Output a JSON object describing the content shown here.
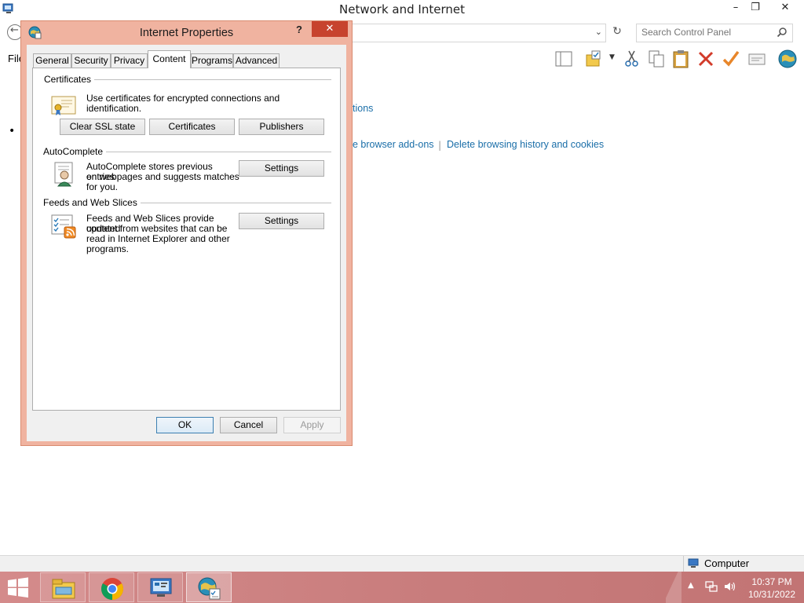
{
  "background_window": {
    "title": "Network and Internet",
    "caption_minimize": "–",
    "caption_restore": "❐",
    "caption_close": "✕",
    "search_placeholder": "Search Control Panel",
    "menu_file": "File",
    "content_fragment_1": "tions",
    "content_fragment_2": "e browser add-ons",
    "separator": "|",
    "link_delete_history": "Delete browsing history and cookies",
    "bullet": "•",
    "status_computer": "Computer"
  },
  "dialog": {
    "title": "Internet Properties",
    "help_button": "?",
    "close_button": "✕",
    "tabs": [
      {
        "label": "General"
      },
      {
        "label": "Security"
      },
      {
        "label": "Privacy"
      },
      {
        "label": "Content"
      },
      {
        "label": "Programs"
      },
      {
        "label": "Advanced"
      }
    ],
    "active_tab": "Content",
    "certificates": {
      "title": "Certificates",
      "description": "Use certificates for encrypted connections and identification.",
      "buttons": [
        "Clear SSL state",
        "Certificates",
        "Publishers"
      ]
    },
    "autocomplete": {
      "title": "AutoComplete",
      "description_lines": [
        "AutoComplete stores previous entries",
        "on webpages and suggests matches",
        "for you."
      ],
      "settings_button": "Settings"
    },
    "feeds": {
      "title": "Feeds and Web Slices",
      "description_lines": [
        "Feeds and Web Slices provide updated",
        "content from websites that can be",
        "read in Internet Explorer and other",
        "programs."
      ],
      "settings_button": "Settings"
    },
    "footer": {
      "ok": "OK",
      "cancel": "Cancel",
      "apply": "Apply"
    }
  },
  "taskbar": {
    "apps": [
      "file-explorer",
      "chrome",
      "control-panel",
      "internet-properties"
    ],
    "active_app": "internet-properties",
    "clock_time": "10:37 PM",
    "clock_date": "10/31/2022",
    "tray_arrow": "▲"
  },
  "colors": {
    "dialog_frame": "#f0b3a0",
    "close_button": "#c7432e",
    "taskbar": "#c87c7c",
    "link": "#1a6ea8"
  }
}
